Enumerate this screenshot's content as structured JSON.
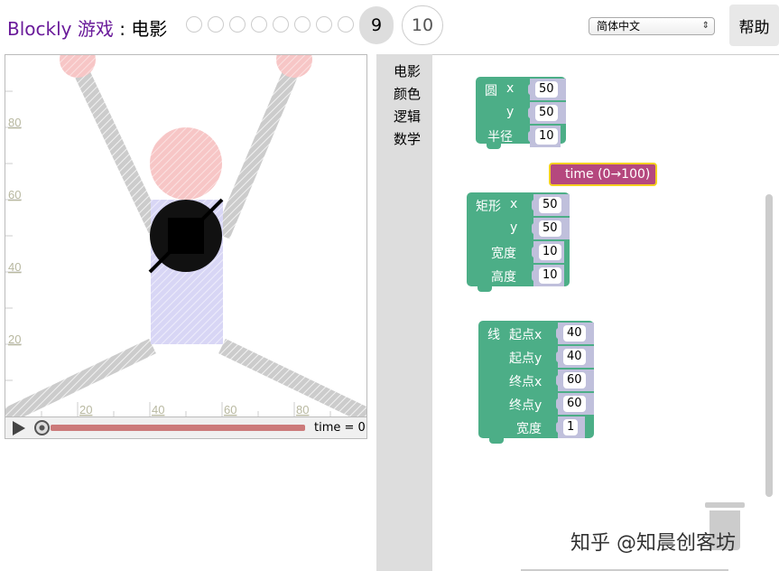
{
  "header": {
    "app": "Blockly 游戏",
    "separator": " : ",
    "level_name": "电影",
    "level_current": "9",
    "level_next": "10",
    "language": "简体中文",
    "help": "帮助"
  },
  "viz": {
    "x_ticks": [
      "20",
      "40",
      "60",
      "80"
    ],
    "y_ticks": [
      "80",
      "60",
      "40",
      "20"
    ],
    "time_label": "time = 0"
  },
  "toolbox": {
    "categories": [
      "电影",
      "颜色",
      "逻辑",
      "数学"
    ]
  },
  "blocks": {
    "circle": {
      "label": "圆",
      "x_lbl": "x",
      "y_lbl": "y",
      "r_lbl": "半径",
      "x": "50",
      "y": "50",
      "r": "10"
    },
    "time": {
      "label": "time (0→100)"
    },
    "rect": {
      "label": "矩形",
      "x_lbl": "x",
      "y_lbl": "y",
      "w_lbl": "宽度",
      "h_lbl": "高度",
      "x": "50",
      "y": "50",
      "w": "10",
      "h": "10"
    },
    "line": {
      "label": "线",
      "x1_lbl": "起点x",
      "y1_lbl": "起点y",
      "x2_lbl": "终点x",
      "y2_lbl": "终点y",
      "w_lbl": "宽度",
      "x1": "40",
      "y1": "40",
      "x2": "60",
      "y2": "60",
      "w": "1"
    }
  },
  "watermark": "知乎 @知晨创客坊",
  "colors": {
    "block_green": "#4cae87",
    "time_block": "#b5487e",
    "highlight": "#f4d020",
    "title_purple": "#6a1b9a"
  }
}
